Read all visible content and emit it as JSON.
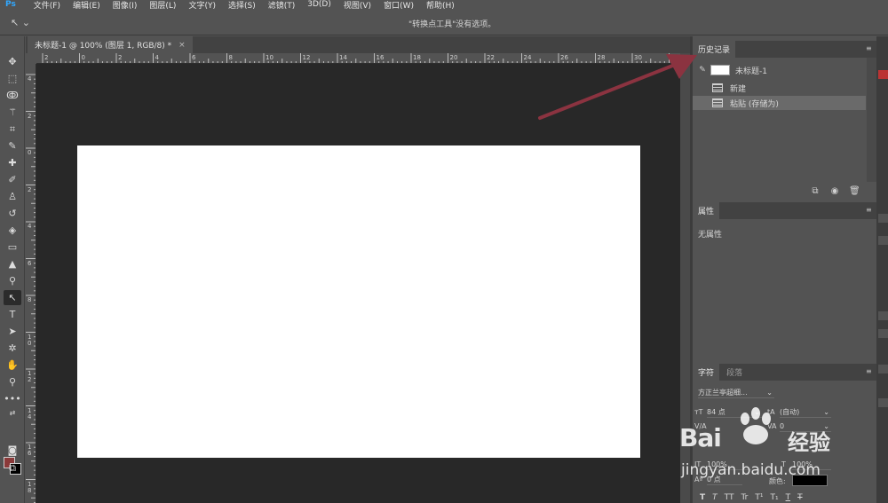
{
  "app": {
    "logo": "Ps"
  },
  "menu": [
    "文件(F)",
    "编辑(E)",
    "图像(I)",
    "图层(L)",
    "文字(Y)",
    "选择(S)",
    "滤镜(T)",
    "3D(D)",
    "视图(V)",
    "窗口(W)",
    "帮助(H)"
  ],
  "options_bar": {
    "tool_preset": "↖ ⌄",
    "message": "\"转换点工具\"没有选项。"
  },
  "document": {
    "tab_title": "未标题-1 @ 100% (图层 1, RGB/8) *",
    "close_glyph": "×"
  },
  "ruler": {
    "horizontal": [
      "2",
      "0",
      "2",
      "4",
      "6",
      "8",
      "10",
      "12",
      "14",
      "16",
      "18",
      "20",
      "22",
      "24",
      "26",
      "28",
      "30",
      "32"
    ],
    "vertical": [
      "4",
      "2",
      "0",
      "2",
      "4",
      "6",
      "8",
      "1 0",
      "1 2",
      "1 4",
      "1 6",
      "1 8"
    ]
  },
  "history_panel": {
    "tab": "历史记录",
    "snapshot": "未标题-1",
    "items": [
      {
        "label": "新建",
        "selected": false
      },
      {
        "label": "粘贴 (存储为)",
        "selected": true
      }
    ]
  },
  "properties_panel": {
    "tab": "属性",
    "empty_text": "无属性"
  },
  "character_panel": {
    "tabs": [
      "字符",
      "段落"
    ],
    "font_family": "方正兰亭超细...",
    "font_size": "84 点",
    "leading": "(自动)",
    "kerning_label": "V/A",
    "tracking": "0",
    "vertical_scale": "100%",
    "horizontal_scale": "100%",
    "baseline_shift": "0 点",
    "color_label": "颜色:",
    "style_buttons": [
      "T",
      "T",
      "TT",
      "Tr",
      "T¹",
      "T₁",
      "T",
      "T"
    ]
  },
  "watermark": {
    "brand": "Bai",
    "brand_cn": "经验",
    "url": "jingyan.baidu.com"
  },
  "colors": {
    "foreground": "#8b3a3a",
    "background": "#000000",
    "canvas": "#ffffff",
    "workspace": "#282828",
    "arrow": "#8b3340"
  }
}
